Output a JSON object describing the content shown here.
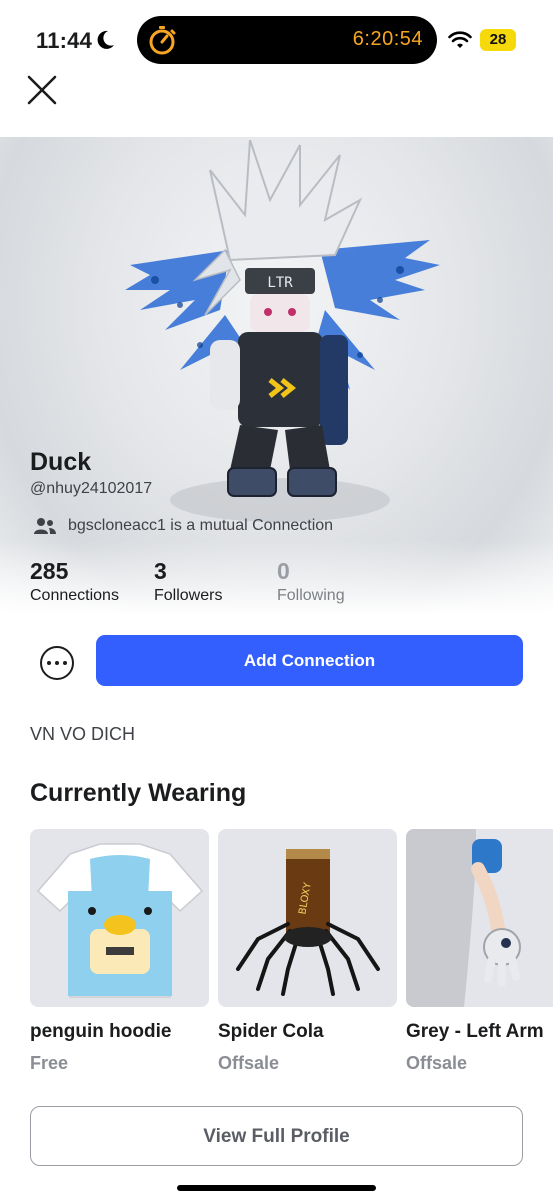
{
  "status_bar": {
    "time": "11:44",
    "timer": "6:20:54",
    "battery": "28",
    "icons": [
      "moon-icon",
      "stopwatch-icon",
      "wifi-icon",
      "battery-icon"
    ]
  },
  "profile": {
    "display_name": "Duck",
    "username": "@nhuy24102017",
    "mutual_text": "bgscloneacc1 is a mutual Connection",
    "about": "VN VO DICH"
  },
  "stats": [
    {
      "value": "285",
      "label": "Connections"
    },
    {
      "value": "3",
      "label": "Followers"
    },
    {
      "value": "0",
      "label": "Following"
    }
  ],
  "actions": {
    "add_connection": "Add Connection",
    "view_full_profile": "View Full Profile"
  },
  "wearing": {
    "title": "Currently Wearing",
    "items": [
      {
        "name": "penguin hoodie",
        "price": "Free"
      },
      {
        "name": "Spider Cola",
        "price": "Offsale"
      },
      {
        "name": "Grey - Left Arm",
        "price": "Offsale"
      }
    ]
  },
  "colors": {
    "primary_button": "#335fff",
    "timer": "#f6a623",
    "battery": "#f5d90a"
  }
}
